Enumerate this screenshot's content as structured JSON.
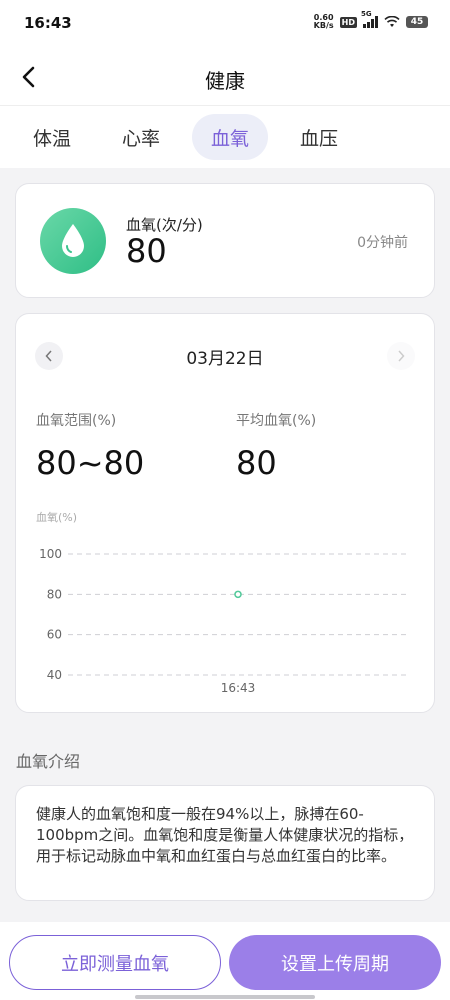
{
  "status": {
    "time": "16:43",
    "net_speed_value": "0.60",
    "net_speed_unit": "KB/s",
    "hd": "HD",
    "net_type": "5G",
    "battery": "45"
  },
  "nav": {
    "title": "健康",
    "back_icon": "chevron-left-icon"
  },
  "tabs": [
    {
      "label": "体温",
      "active": false
    },
    {
      "label": "心率",
      "active": false
    },
    {
      "label": "血氧",
      "active": true
    },
    {
      "label": "血压",
      "active": false
    }
  ],
  "current": {
    "label": "血氧(次/分)",
    "value": "80",
    "time_ago": "0分钟前",
    "icon": "water-drop-icon",
    "icon_color": "#3cc48e"
  },
  "day": {
    "date": "03月22日",
    "range_label": "血氧范围(%)",
    "range_value": "80~80",
    "avg_label": "平均血氧(%)",
    "avg_value": "80"
  },
  "chart_data": {
    "type": "scatter",
    "ylabel": "血氧(%)",
    "ylim": [
      40,
      100
    ],
    "yticks": [
      "100",
      "80",
      "60",
      "40"
    ],
    "x": [
      "16:43"
    ],
    "values": [
      80
    ],
    "grid": true,
    "point_color": "#52c99a"
  },
  "intro": {
    "title": "血氧介绍",
    "text": "健康人的血氧饱和度一般在94%以上，脉搏在60-100bpm之间。血氧饱和度是衡量人体健康状况的指标，用于标记动脉血中氧和血红蛋白与总血红蛋白的比率。"
  },
  "buttons": {
    "measure": "立即测量血氧",
    "upload": "设置上传周期"
  },
  "colors": {
    "accent": "#7b61d8",
    "accent_fill": "#9b7fe8"
  }
}
